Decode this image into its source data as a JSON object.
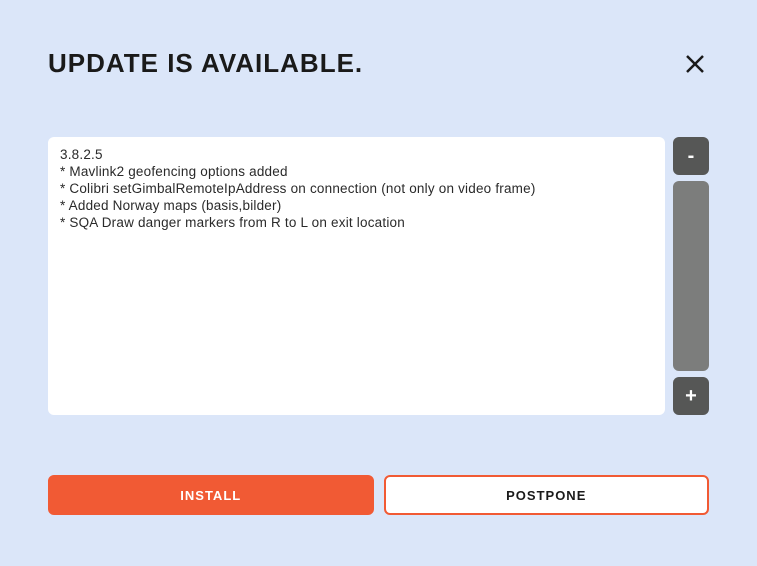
{
  "header": {
    "title": "UPDATE IS AVAILABLE."
  },
  "changelog": {
    "version": "3.8.2.5",
    "items": [
      "Mavlink2 geofencing options added",
      "Colibri setGimbalRemoteIpAddress on connection (not only on video frame)",
      "Added Norway maps (basis,bilder)",
      "SQA Draw danger markers from R to L on exit location"
    ]
  },
  "zoom": {
    "minus_label": "-",
    "plus_label": "+"
  },
  "buttons": {
    "install_label": "INSTALL",
    "postpone_label": "POSTPONE"
  },
  "colors": {
    "background": "#dbe6f9",
    "accent": "#f15a34",
    "zoom_dark": "#565756",
    "zoom_light": "#7c7d7c"
  }
}
